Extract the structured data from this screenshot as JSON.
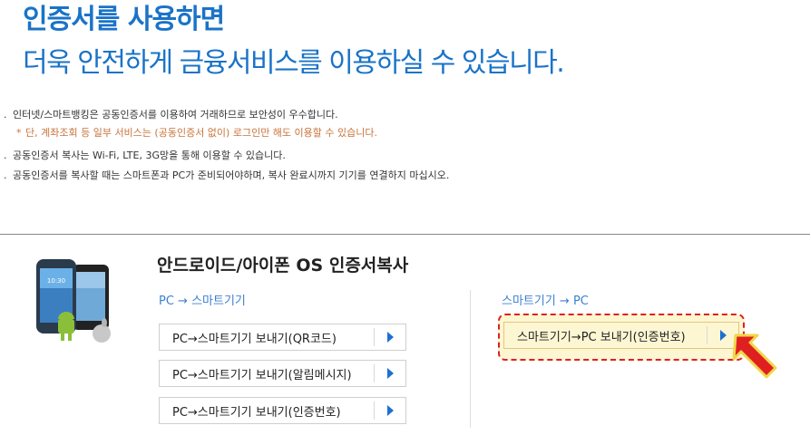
{
  "hero": {
    "title": "인증서를 사용하면",
    "subtitle": "더욱 안전하게 금융서비스를 이용하실 수 있습니다."
  },
  "notes": [
    {
      "bullet": ".",
      "text": "인터넷/스마트뱅킹은 공동인증서를 이용하여 거래하므로 보안성이 우수합니다."
    },
    {
      "bullet": "*",
      "text": "단, 계좌조회 등 일부 서비스는 (공동인증서 없이) 로그인만 해도 이용할 수 있습니다.",
      "warning": true
    },
    {
      "bullet": ".",
      "text": "공동인증서 복사는 Wi-Fi, LTE, 3G망을 통해 이용할 수 있습니다."
    },
    {
      "bullet": ".",
      "text": "공동인증서를 복사할 때는 스마트폰과 PC가 준비되어야하며, 복사 완료시까지 기기를 연결하지 마십시오."
    }
  ],
  "section": {
    "title": "안드로이드/아이폰 OS 인증서복사",
    "left_column": {
      "label": "PC → 스마트기기",
      "buttons": [
        "PC→스마트기기 보내기(QR코드)",
        "PC→스마트기기 보내기(알림메시지)",
        "PC→스마트기기 보내기(인증번호)"
      ]
    },
    "right_column": {
      "label": "스마트기기 → PC",
      "buttons": [
        "스마트기기→PC 보내기(인증번호)"
      ]
    }
  },
  "colors": {
    "accent_blue": "#1a73c8",
    "warning_orange": "#c8733a",
    "highlight_red": "#e02020",
    "highlight_bg": "#fdf6d3"
  },
  "icons": [
    "devices-illustration",
    "android-icon",
    "apple-icon",
    "red-pointer-arrow-icon",
    "right-triangle-icon"
  ]
}
